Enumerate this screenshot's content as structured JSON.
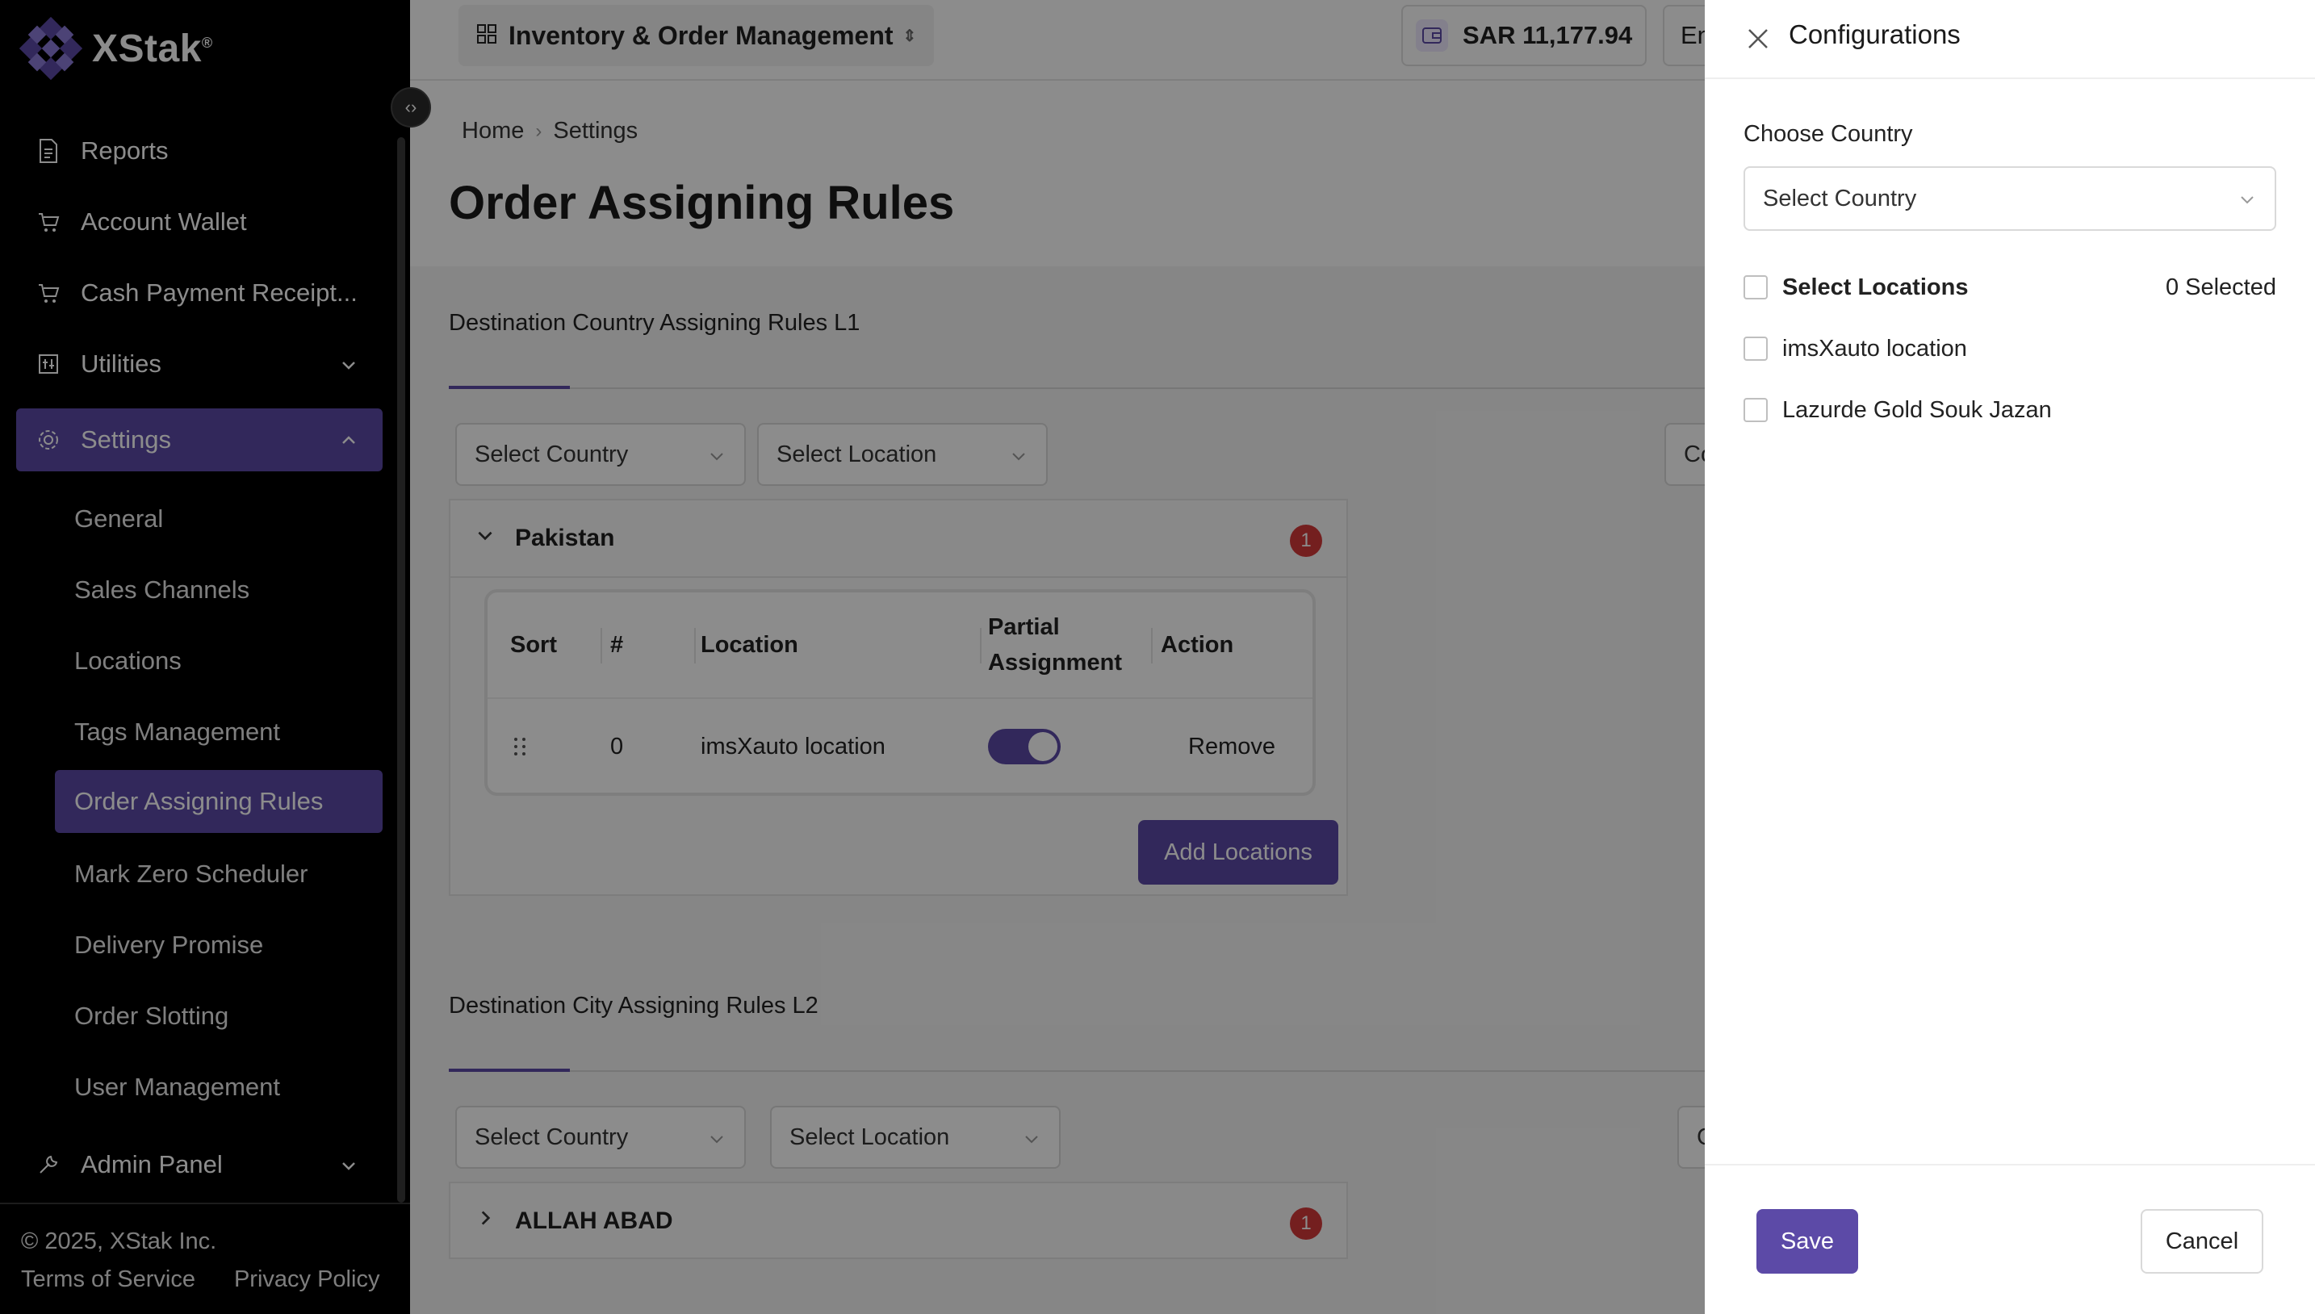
{
  "brand": {
    "name": "XStak",
    "mark": "®"
  },
  "sidebar": {
    "items": [
      {
        "label": "Reports",
        "icon": "report-icon"
      },
      {
        "label": "Account Wallet",
        "icon": "cart-icon"
      },
      {
        "label": "Cash Payment Receipt...",
        "icon": "cart-icon"
      },
      {
        "label": "Utilities",
        "icon": "utilities-icon"
      },
      {
        "label": "Settings",
        "icon": "gear-icon"
      },
      {
        "label": "Admin Panel",
        "icon": "wrench-icon"
      }
    ],
    "settings_sub": [
      {
        "label": "General"
      },
      {
        "label": "Sales Channels"
      },
      {
        "label": "Locations"
      },
      {
        "label": "Tags Management"
      },
      {
        "label": "Order Assigning Rules"
      },
      {
        "label": "Mark Zero Scheduler"
      },
      {
        "label": "Delivery Promise"
      },
      {
        "label": "Order Slotting"
      },
      {
        "label": "User Management"
      }
    ],
    "footer": {
      "copyright": "© 2025, XStak Inc.",
      "terms": "Terms of Service",
      "privacy": "Privacy Policy"
    }
  },
  "topbar": {
    "app_name": "Inventory & Order Management",
    "wallet_balance": "SAR 11,177.94",
    "language": "En"
  },
  "breadcrumb": {
    "home": "Home",
    "current": "Settings"
  },
  "page_title": "Order Assigning Rules",
  "section1": {
    "title": "Destination Country Assigning Rules L1",
    "country_placeholder": "Select Country",
    "location_placeholder": "Select Location",
    "partial_btn": "Co",
    "group": {
      "name": "Pakistan",
      "badge": "1",
      "columns": {
        "sort": "Sort",
        "num": "#",
        "location": "Location",
        "partial_line1": "Partial",
        "partial_line2": "Assignment",
        "action": "Action"
      },
      "rows": [
        {
          "num": "0",
          "location": "imsXauto location",
          "partial": true,
          "action": "Remove"
        }
      ],
      "add_button": "Add Locations"
    }
  },
  "section2": {
    "title": "Destination City Assigning Rules L2",
    "country_placeholder": "Select Country",
    "location_placeholder": "Select Location",
    "partial_btn": "C",
    "group": {
      "name": "ALLAH ABAD",
      "badge": "1"
    }
  },
  "drawer": {
    "title": "Configurations",
    "country_label": "Choose Country",
    "country_placeholder": "Select Country",
    "select_all_label": "Select Locations",
    "selected_count": "0 Selected",
    "locations": [
      "imsXauto location",
      "Lazurde Gold Souk Jazan"
    ],
    "save": "Save",
    "cancel": "Cancel"
  },
  "colors": {
    "accent": "#5c4aa7",
    "sidebar_bg": "#000000",
    "badge": "#d33a3a"
  }
}
